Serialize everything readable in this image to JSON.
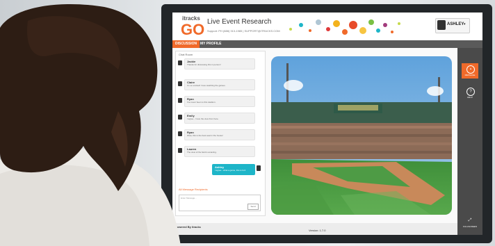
{
  "app": {
    "logo_top": "itracks",
    "logo_go": "GO",
    "title": "Live Event Research",
    "subtitle": "Support: PH (888) 313-1985 | SUPPORT@ITRACKS.COM"
  },
  "user": {
    "name": "ASHLEY",
    "caret": "▾"
  },
  "nav": {
    "tab_active": "DISCUSSION",
    "tab_profile": "MY PROFILE"
  },
  "chat": {
    "header": "Chat Room",
    "messages": [
      {
        "name": "Jackie",
        "text": "Thanks for discussing this in person!"
      },
      {
        "name": "Claire",
        "text": "I'm so excited! I love watching the games."
      },
      {
        "name": "Ryan",
        "text": "I've never been to this stadium."
      },
      {
        "name": "Emily",
        "text": "I agree - I love the view from here."
      },
      {
        "name": "Ryan",
        "text": "Wow, this is the best seat in the house!"
      },
      {
        "name": "Lauren",
        "text": "The view of the field is amazing."
      },
      {
        "name": "Ashley",
        "text": "I agree - what a game, this is fun!"
      }
    ],
    "input_label": "All Message Recipients",
    "input_placeholder": "Enter Message...",
    "send_label": "Send"
  },
  "sidebar": {
    "items": [
      {
        "label": "MESSAGE",
        "icon": "chat-icon"
      },
      {
        "label": "HELP",
        "icon": "help-icon"
      },
      {
        "label": "FULLSCREEN",
        "icon": "fullscreen-icon"
      }
    ]
  },
  "footer": {
    "powered": "Powered By itracks",
    "version": "Version: 1.7.0"
  },
  "colors": {
    "accent": "#f06a2a",
    "bubble": "#1eb5c8",
    "sidebar": "#4a4a4a"
  }
}
